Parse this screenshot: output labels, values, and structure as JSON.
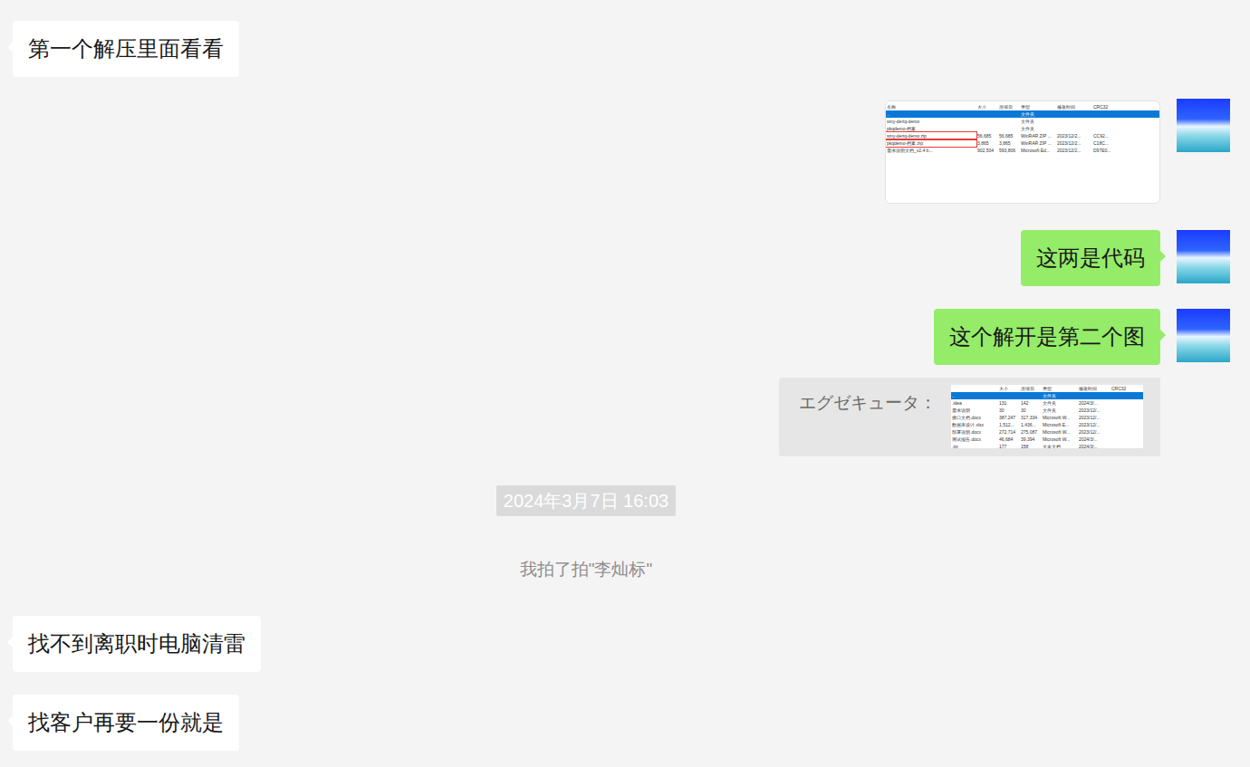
{
  "messages": [
    {
      "kind": "text",
      "side": "left",
      "text": "第一个解压里面看看"
    },
    {
      "kind": "image",
      "side": "right",
      "file_list": {
        "columns": [
          "名称",
          "大小",
          "压缩后",
          "类型",
          "修改时间",
          "CRC32"
        ],
        "rows": [
          {
            "cells": [
              "..",
              "",
              "",
              "文件夹",
              "",
              ""
            ],
            "selected": true,
            "highlighted": false
          },
          {
            "cells": [
              "smy-deriq-demo",
              "",
              "",
              "文件夹",
              "",
              ""
            ],
            "selected": false,
            "highlighted": false
          },
          {
            "cells": [
              "pkqdemo-档案",
              "",
              "",
              "文件夹",
              "",
              ""
            ],
            "selected": false,
            "highlighted": false
          },
          {
            "cells": [
              "smy-deriq-demo.zip",
              "56,685",
              "56,685",
              "WinRAR ZIP ...",
              "2023/12/2...",
              "CC92..."
            ],
            "selected": false,
            "highlighted": true
          },
          {
            "cells": [
              "pkqdemo-档案.zip",
              "3,865",
              "3,865",
              "WinRAR ZIP ...",
              "2023/12/2...",
              "C18C..."
            ],
            "selected": false,
            "highlighted": true
          },
          {
            "cells": [
              "需求说明文档_v2.4 b...",
              "902,504",
              "593,806",
              "Microsoft Ed...",
              "2023/12/2...",
              "D97E0..."
            ],
            "selected": false,
            "highlighted": false
          }
        ]
      }
    },
    {
      "kind": "text",
      "side": "right",
      "text": "这两是代码"
    },
    {
      "kind": "text",
      "side": "right",
      "text": "这个解开是第二个图"
    },
    {
      "kind": "quote",
      "side": "right",
      "author": "エグゼキュータ：",
      "file_list": {
        "columns": [
          "",
          "大小",
          "压缩后",
          "类型",
          "修改时间",
          "CRC32"
        ],
        "rows": [
          {
            "cells": [
              "..",
              "",
              "",
              "文件夹",
              "",
              ""
            ],
            "selected": true,
            "highlighted": false
          },
          {
            "cells": [
              ".idea",
              "131",
              "142",
              "文件夹",
              "2024/3/...",
              ""
            ],
            "selected": false,
            "highlighted": false
          },
          {
            "cells": [
              "需求说明",
              "30",
              "30",
              "文件夹",
              "2023/12/...",
              ""
            ],
            "selected": false,
            "highlighted": false
          },
          {
            "cells": [
              "接口文档.docx",
              "387,247",
              "317,334",
              "Microsoft W...",
              "2023/12/...",
              ""
            ],
            "selected": false,
            "highlighted": false
          },
          {
            "cells": [
              "数据库设计.xlsx",
              "1,512...",
              "1,436...",
              "Microsoft E...",
              "2023/12/...",
              ""
            ],
            "selected": false,
            "highlighted": false
          },
          {
            "cells": [
              "部署说明.docx",
              "272,714",
              "275,087",
              "Microsoft W...",
              "2023/12/...",
              ""
            ],
            "selected": false,
            "highlighted": false
          },
          {
            "cells": [
              "测试报告.docx",
              "46,684",
              "39,394",
              "Microsoft W...",
              "2024/3/...",
              ""
            ],
            "selected": false,
            "highlighted": false
          },
          {
            "cells": [
              ".txt",
              "177",
              "158",
              "文本文档",
              "2024/3/...",
              ""
            ],
            "selected": false,
            "highlighted": false
          }
        ]
      }
    },
    {
      "kind": "time",
      "text": "2024年3月7日 16:03"
    },
    {
      "kind": "system",
      "text": "我拍了拍\"李灿标\""
    },
    {
      "kind": "text",
      "side": "left",
      "text": "找不到离职时电脑清雷"
    },
    {
      "kind": "text",
      "side": "left",
      "text": "找客户再要一份就是"
    }
  ]
}
